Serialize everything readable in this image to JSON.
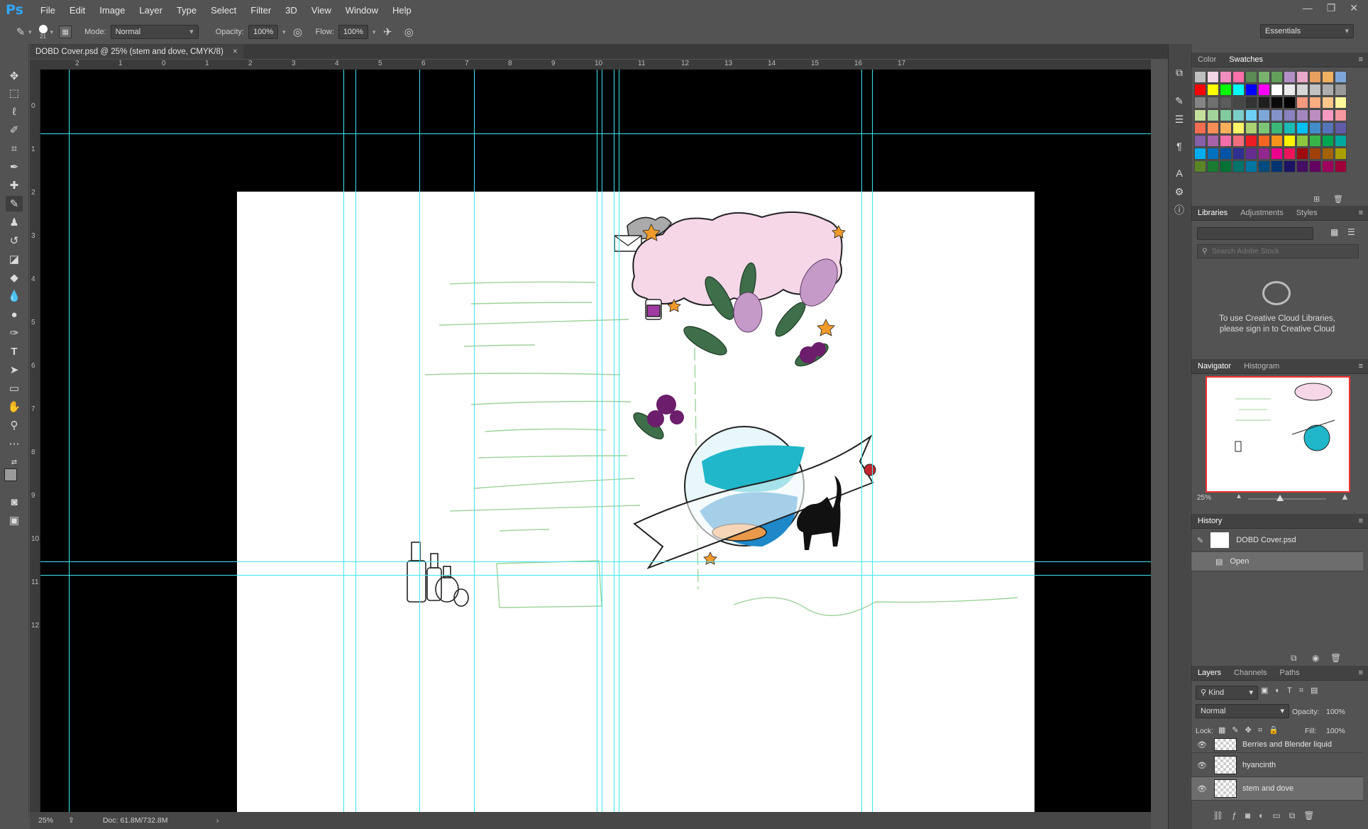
{
  "app": {
    "logo": "Ps"
  },
  "menu": [
    "File",
    "Edit",
    "Image",
    "Layer",
    "Type",
    "Select",
    "Filter",
    "3D",
    "View",
    "Window",
    "Help"
  ],
  "window_buttons": [
    "—",
    "❐",
    "✕"
  ],
  "options_bar": {
    "brush_size": "21",
    "mode_label": "Mode:",
    "mode_value": "Normal",
    "opacity_label": "Opacity:",
    "opacity_value": "100%",
    "flow_label": "Flow:",
    "flow_value": "100%",
    "workspace": "Essentials"
  },
  "document_tab": {
    "title": "DOBD Cover.psd @ 25% (stem and dove, CMYK/8)",
    "close": "×"
  },
  "ruler_top_ticks": [
    "2",
    "1",
    "0",
    "1",
    "2",
    "3",
    "4",
    "5",
    "6",
    "7",
    "8",
    "9",
    "10",
    "11",
    "12",
    "13",
    "14",
    "15",
    "16",
    "17"
  ],
  "ruler_left_ticks": [
    "0",
    "1",
    "2",
    "3",
    "4",
    "5",
    "6",
    "7",
    "8",
    "9",
    "10",
    "11",
    "12"
  ],
  "status_bar": {
    "zoom": "25%",
    "doc": "Doc: 61.8M/732.8M",
    "arrow": "›"
  },
  "color_panel": {
    "tabs": [
      "Color",
      "Swatches"
    ],
    "active": "Swatches"
  },
  "swatches": [
    "#bfbfbf",
    "#f2d6e5",
    "#f08fbf",
    "#ff6fa8",
    "#5d8a55",
    "#7ab06e",
    "#63a05a",
    "#b38fc7",
    "#e8a9c8",
    "#e8a060",
    "#f0b060",
    "#7fa6d8",
    "#ff0000",
    "#ffff00",
    "#00ff00",
    "#00ffff",
    "#0000ff",
    "#ff00ff",
    "#ffffff",
    "#ebebeb",
    "#d6d6d6",
    "#c2c2c2",
    "#adadad",
    "#999999",
    "#858585",
    "#707070",
    "#5c5c5c",
    "#474747",
    "#333333",
    "#1f1f1f",
    "#0a0a0a",
    "#000000",
    "#f79a7e",
    "#f9ad81",
    "#fdc68a",
    "#fff799",
    "#c4df9b",
    "#a3d39c",
    "#82ca9d",
    "#7bcdc8",
    "#6ecff6",
    "#7ea7d8",
    "#8493ca",
    "#8882be",
    "#a187be",
    "#bc8dbf",
    "#f49ac1",
    "#f5989d",
    "#f26c4f",
    "#f68e55",
    "#fbaf5c",
    "#fff467",
    "#acd372",
    "#7cc576",
    "#3bb878",
    "#1abbb4",
    "#00bff3",
    "#438cca",
    "#5574b9",
    "#605ca8",
    "#855fa8",
    "#a763a8",
    "#f06ea9",
    "#f26d7d",
    "#ed1c24",
    "#f26522",
    "#f7941d",
    "#fff200",
    "#8dc63f",
    "#39b54a",
    "#00a651",
    "#00a99d",
    "#00aeef",
    "#0072bc",
    "#0054a6",
    "#2e3192",
    "#662d91",
    "#92278f",
    "#ec008c",
    "#ed145b",
    "#9e0b0f",
    "#a0410d",
    "#a36209",
    "#aba000",
    "#598527",
    "#1a7b30",
    "#007236",
    "#00746b",
    "#0076a3",
    "#004b80",
    "#003471",
    "#1b1464",
    "#440e62",
    "#630460",
    "#9e005d",
    "#9e0039"
  ],
  "libraries_panel": {
    "tabs": [
      "Libraries",
      "Adjustments",
      "Styles"
    ],
    "active": "Libraries",
    "search_placeholder": "Search Adobe Stock",
    "message_line1": "To use Creative Cloud Libraries,",
    "message_line2": "please sign in to Creative Cloud"
  },
  "navigator_panel": {
    "tabs": [
      "Navigator",
      "Histogram"
    ],
    "active": "Navigator",
    "zoom": "25%"
  },
  "history_panel": {
    "title": "History",
    "items": [
      "DOBD Cover.psd",
      "Open"
    ]
  },
  "layers_panel": {
    "tabs": [
      "Layers",
      "Channels",
      "Paths"
    ],
    "active": "Layers",
    "kind_label": "Kind",
    "blend_mode": "Normal",
    "opacity_label": "Opacity:",
    "opacity_value": "100%",
    "lock_label": "Lock:",
    "fill_label": "Fill:",
    "fill_value": "100%",
    "layers": [
      "Berries and Blender liquid",
      "hyancinth",
      "stem and dove"
    ]
  }
}
